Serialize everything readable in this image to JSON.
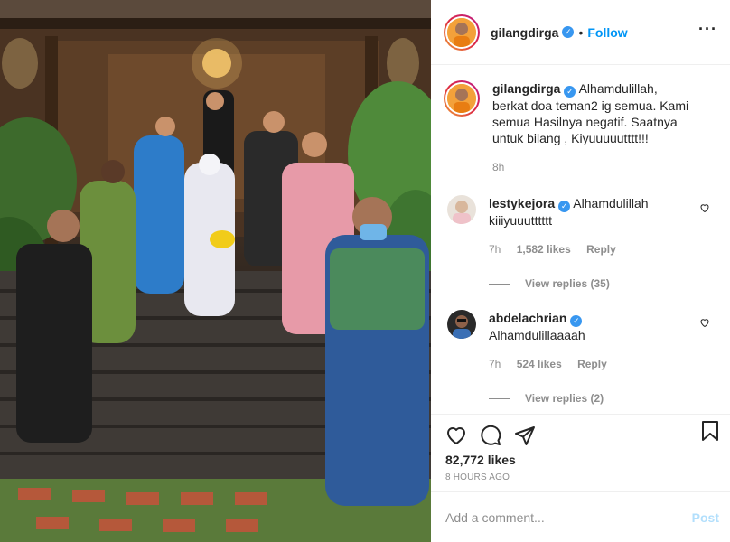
{
  "post": {
    "username": "gilangdirga",
    "follow_label": "Follow",
    "dot": "•",
    "more": "···"
  },
  "caption": {
    "username": "gilangdirga",
    "text": "Alhamdulillah, berkat doa teman2 ig semua. Kami semua Hasilnya negatif. Saatnya untuk bilang , Kiyuuuuutttt!!!",
    "time": "8h"
  },
  "comments": [
    {
      "username": "lestykejora",
      "text": "Alhamdulillah kiiiyuuutttttt",
      "time": "7h",
      "likes": "1,582 likes",
      "reply_label": "Reply",
      "view_replies": "View replies (35)"
    },
    {
      "username": "abdelachrian",
      "text": "Alhamdulillaaaah",
      "time": "7h",
      "likes": "524 likes",
      "reply_label": "Reply",
      "view_replies": "View replies (2)"
    }
  ],
  "engagement": {
    "likes": "82,772 likes",
    "time_ago": "8 HOURS AGO"
  },
  "add_comment": {
    "placeholder": "Add a comment...",
    "post_label": "Post"
  },
  "colors": {
    "accent": "#0095f6",
    "verified": "#3897f0",
    "muted": "#8e8e8e",
    "post_disabled": "#b2dffc"
  },
  "icons": [
    "heart-icon",
    "comment-icon",
    "share-icon",
    "bookmark-icon",
    "verified-icon",
    "more-icon"
  ]
}
